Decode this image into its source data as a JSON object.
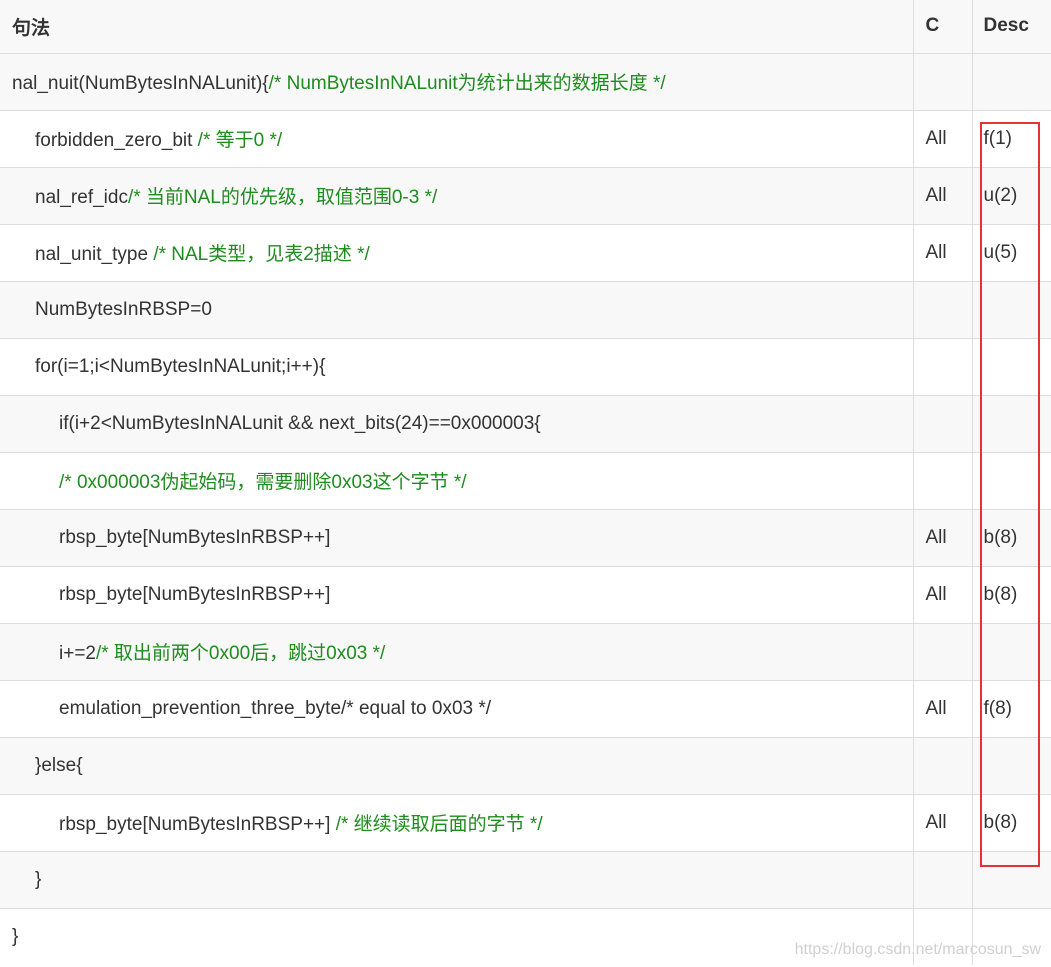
{
  "headers": {
    "syntax": "句法",
    "c": "C",
    "desc": "Desc"
  },
  "rows": [
    {
      "code": "nal_nuit(NumBytesInNALunit){",
      "comment": "/* NumBytesInNALunit为统计出来的数据长度 */",
      "c": "",
      "desc": "",
      "indent": 0
    },
    {
      "code": "forbidden_zero_bit ",
      "comment": "/* 等于0 */",
      "c": "All",
      "desc": "f(1)",
      "indent": 1
    },
    {
      "code": "nal_ref_idc",
      "comment": "/* 当前NAL的优先级，取值范围0-3 */",
      "c": "All",
      "desc": "u(2)",
      "indent": 1
    },
    {
      "code": "nal_unit_type ",
      "comment": "/* NAL类型，见表2描述 */",
      "c": "All",
      "desc": "u(5)",
      "indent": 1
    },
    {
      "code": "NumBytesInRBSP=0",
      "comment": "",
      "c": "",
      "desc": "",
      "indent": 1
    },
    {
      "code": "for(i=1;i<NumBytesInNALunit;i++){",
      "comment": "",
      "c": "",
      "desc": "",
      "indent": 1
    },
    {
      "code": "if(i+2<NumBytesInNALunit && next_bits(24)==0x000003{",
      "comment": "",
      "c": "",
      "desc": "",
      "indent": 2
    },
    {
      "code": "",
      "comment": "/* 0x000003伪起始码，需要删除0x03这个字节 */",
      "c": "",
      "desc": "",
      "indent": 2
    },
    {
      "code": "rbsp_byte[NumBytesInRBSP++]",
      "comment": "",
      "c": "All",
      "desc": "b(8)",
      "indent": 2
    },
    {
      "code": "rbsp_byte[NumBytesInRBSP++]",
      "comment": "",
      "c": "All",
      "desc": "b(8)",
      "indent": 2
    },
    {
      "code": "i+=2",
      "comment": "/* 取出前两个0x00后，跳过0x03 */",
      "c": "",
      "desc": "",
      "indent": 2
    },
    {
      "code": "emulation_prevention_three_byte/* equal to 0x03 */",
      "comment": "",
      "c": "All",
      "desc": "f(8)",
      "indent": 2
    },
    {
      "code": "}else{",
      "comment": "",
      "c": "",
      "desc": "",
      "indent": 1
    },
    {
      "code": "rbsp_byte[NumBytesInRBSP++] ",
      "comment": "/* 继续读取后面的字节 */",
      "c": "All",
      "desc": "b(8)",
      "indent": 2
    },
    {
      "code": "}",
      "comment": "",
      "c": "",
      "desc": "",
      "indent": 1
    },
    {
      "code": "}",
      "comment": "",
      "c": "",
      "desc": "",
      "indent": 0
    }
  ],
  "watermark": "https://blog.csdn.net/marcosun_sw",
  "colors": {
    "comment": "#1e8c1e",
    "highlight": "#e53333"
  }
}
